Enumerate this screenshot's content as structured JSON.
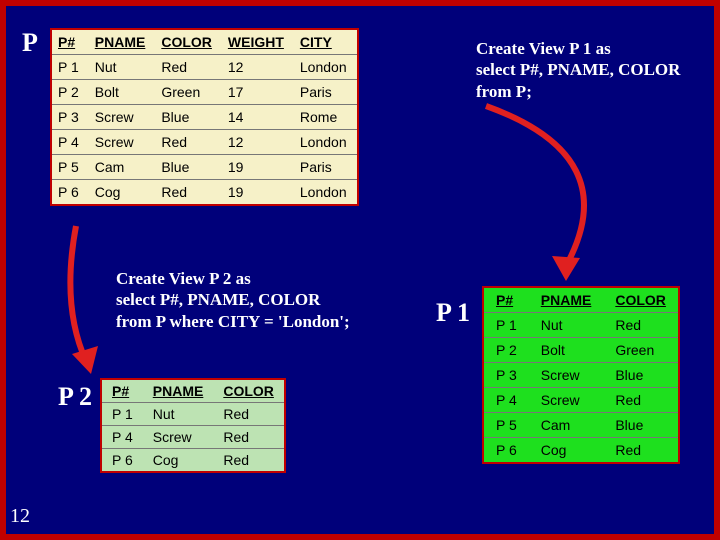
{
  "labels": {
    "P": "P",
    "P1": "P 1",
    "P2": "P 2"
  },
  "sql1": {
    "l1": "Create View P 1 as",
    "l2": "select P#, PNAME, COLOR",
    "l3": "from P;"
  },
  "sql2": {
    "l1": "Create View P 2 as",
    "l2": "select P#, PNAME, COLOR",
    "l3": "from P where CITY = 'London';"
  },
  "tableP": {
    "headers": [
      "P#",
      "PNAME",
      "COLOR",
      "WEIGHT",
      "CITY"
    ],
    "rows": [
      [
        "P 1",
        "Nut",
        "Red",
        "12",
        "London"
      ],
      [
        "P 2",
        "Bolt",
        "Green",
        "17",
        "Paris"
      ],
      [
        "P 3",
        "Screw",
        "Blue",
        "14",
        "Rome"
      ],
      [
        "P 4",
        "Screw",
        "Red",
        "12",
        "London"
      ],
      [
        "P 5",
        "Cam",
        "Blue",
        "19",
        "Paris"
      ],
      [
        "P 6",
        "Cog",
        "Red",
        "19",
        "London"
      ]
    ]
  },
  "tableP2": {
    "headers": [
      "P#",
      "PNAME",
      "COLOR"
    ],
    "rows": [
      [
        "P 1",
        "Nut",
        "Red"
      ],
      [
        "P 4",
        "Screw",
        "Red"
      ],
      [
        "P 6",
        "Cog",
        "Red"
      ]
    ]
  },
  "tableP1": {
    "headers": [
      "P#",
      "PNAME",
      "COLOR"
    ],
    "rows": [
      [
        "P 1",
        "Nut",
        "Red"
      ],
      [
        "P 2",
        "Bolt",
        "Green"
      ],
      [
        "P 3",
        "Screw",
        "Blue"
      ],
      [
        "P 4",
        "Screw",
        "Red"
      ],
      [
        "P 5",
        "Cam",
        "Blue"
      ],
      [
        "P 6",
        "Cog",
        "Red"
      ]
    ]
  },
  "slide_number": "12"
}
